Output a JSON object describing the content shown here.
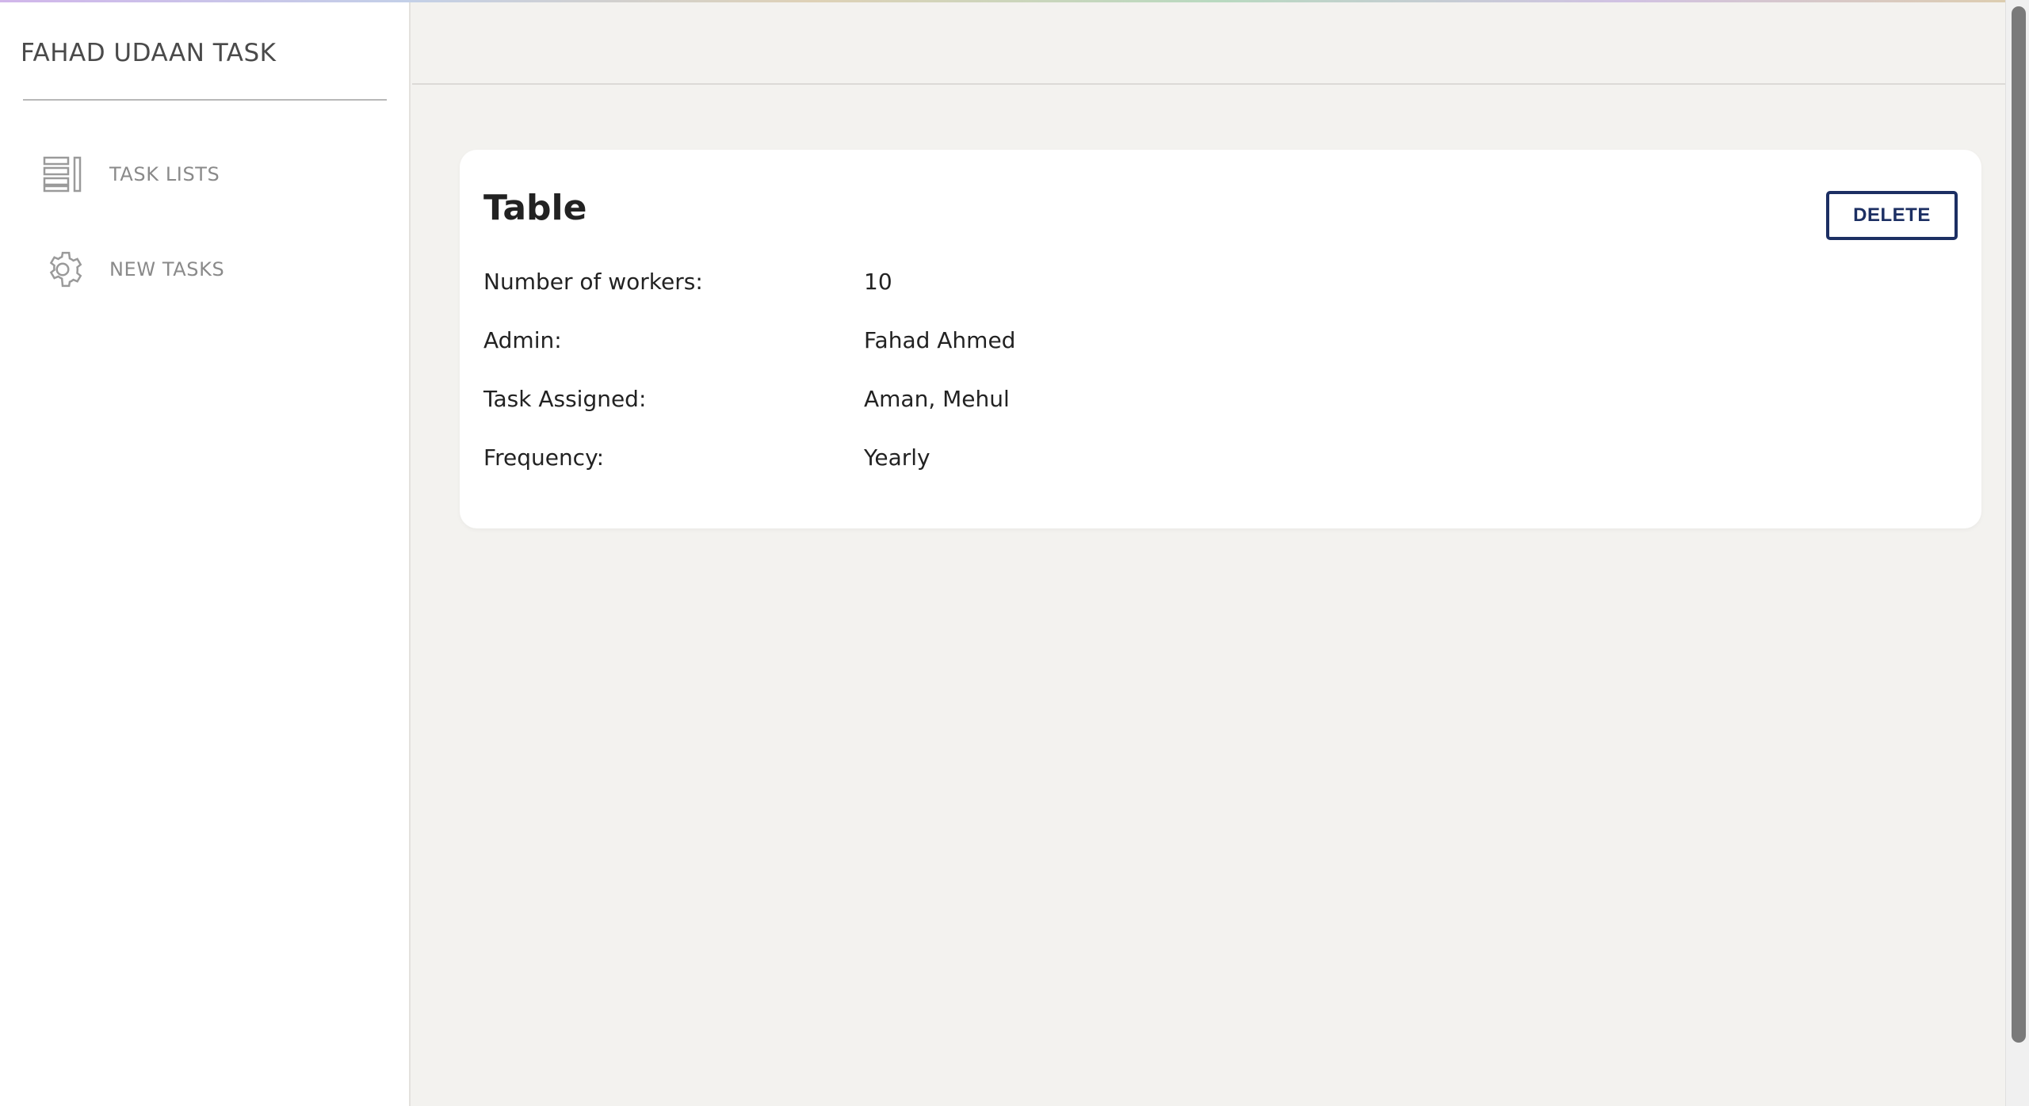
{
  "sidebar": {
    "brand": "FAHAD UDAAN TASK",
    "items": [
      {
        "label": "TASK LISTS",
        "icon": "list-icon"
      },
      {
        "label": "NEW TASKS",
        "icon": "gear-icon"
      }
    ]
  },
  "card": {
    "title": "Table",
    "delete_label": "DELETE",
    "rows": [
      {
        "key": "Number of workers:",
        "value": "10"
      },
      {
        "key": "Admin:",
        "value": "Fahad Ahmed"
      },
      {
        "key": "Task Assigned:",
        "value": "Aman, Mehul"
      },
      {
        "key": "Frequency:",
        "value": "Yearly"
      }
    ]
  },
  "colors": {
    "background": "#f3f2ef",
    "card": "#ffffff",
    "accent": "#1c2f63",
    "nav_text": "#8a8a8a"
  }
}
